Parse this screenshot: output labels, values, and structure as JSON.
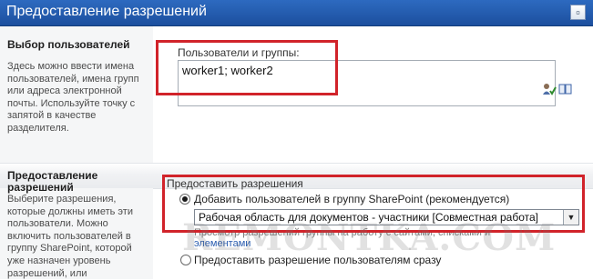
{
  "dialog": {
    "title": "Предоставление разрешений",
    "close_glyph": "▫"
  },
  "select_users": {
    "heading": "Выбор пользователей",
    "description_lines": [
      "Здесь можно ввести имена",
      "пользователей, имена групп",
      "или адреса электронной",
      "почты. Используйте точку с",
      "запятой в качестве",
      "разделителя."
    ],
    "field_label": "Пользователи и группы:",
    "field_value": "worker1; worker2",
    "check_names_icon": "check-names-icon",
    "browse_icon": "address-book-icon"
  },
  "grant_permissions": {
    "heading_lines": [
      "Предоставление",
      "разрешений"
    ],
    "description_lines": [
      "Выберите разрешения,",
      "которые должны иметь эти",
      "пользователи. Можно",
      "включить пользователей в",
      "группу SharePoint, которой",
      "уже назначен уровень",
      "разрешений, или"
    ],
    "group_label": "Предоставить разрешения",
    "option_add_group": "Добавить пользователей в группу SharePoint (рекомендуется)",
    "group_select_value": "Рабочая область для документов - участники [Совместная работа]",
    "hint_text": "Просмотр разрешений группы на работу с сайтами, списками и",
    "hint_link": "элементами",
    "option_direct": "Предоставить разрешение пользователям сразу",
    "option_add_group_selected": true
  },
  "watermark": "REMONTKA.COM",
  "colors": {
    "titlebar": "#1c4f9e",
    "highlight_box": "#d1232a",
    "section_bg": "#f5f6f7"
  }
}
